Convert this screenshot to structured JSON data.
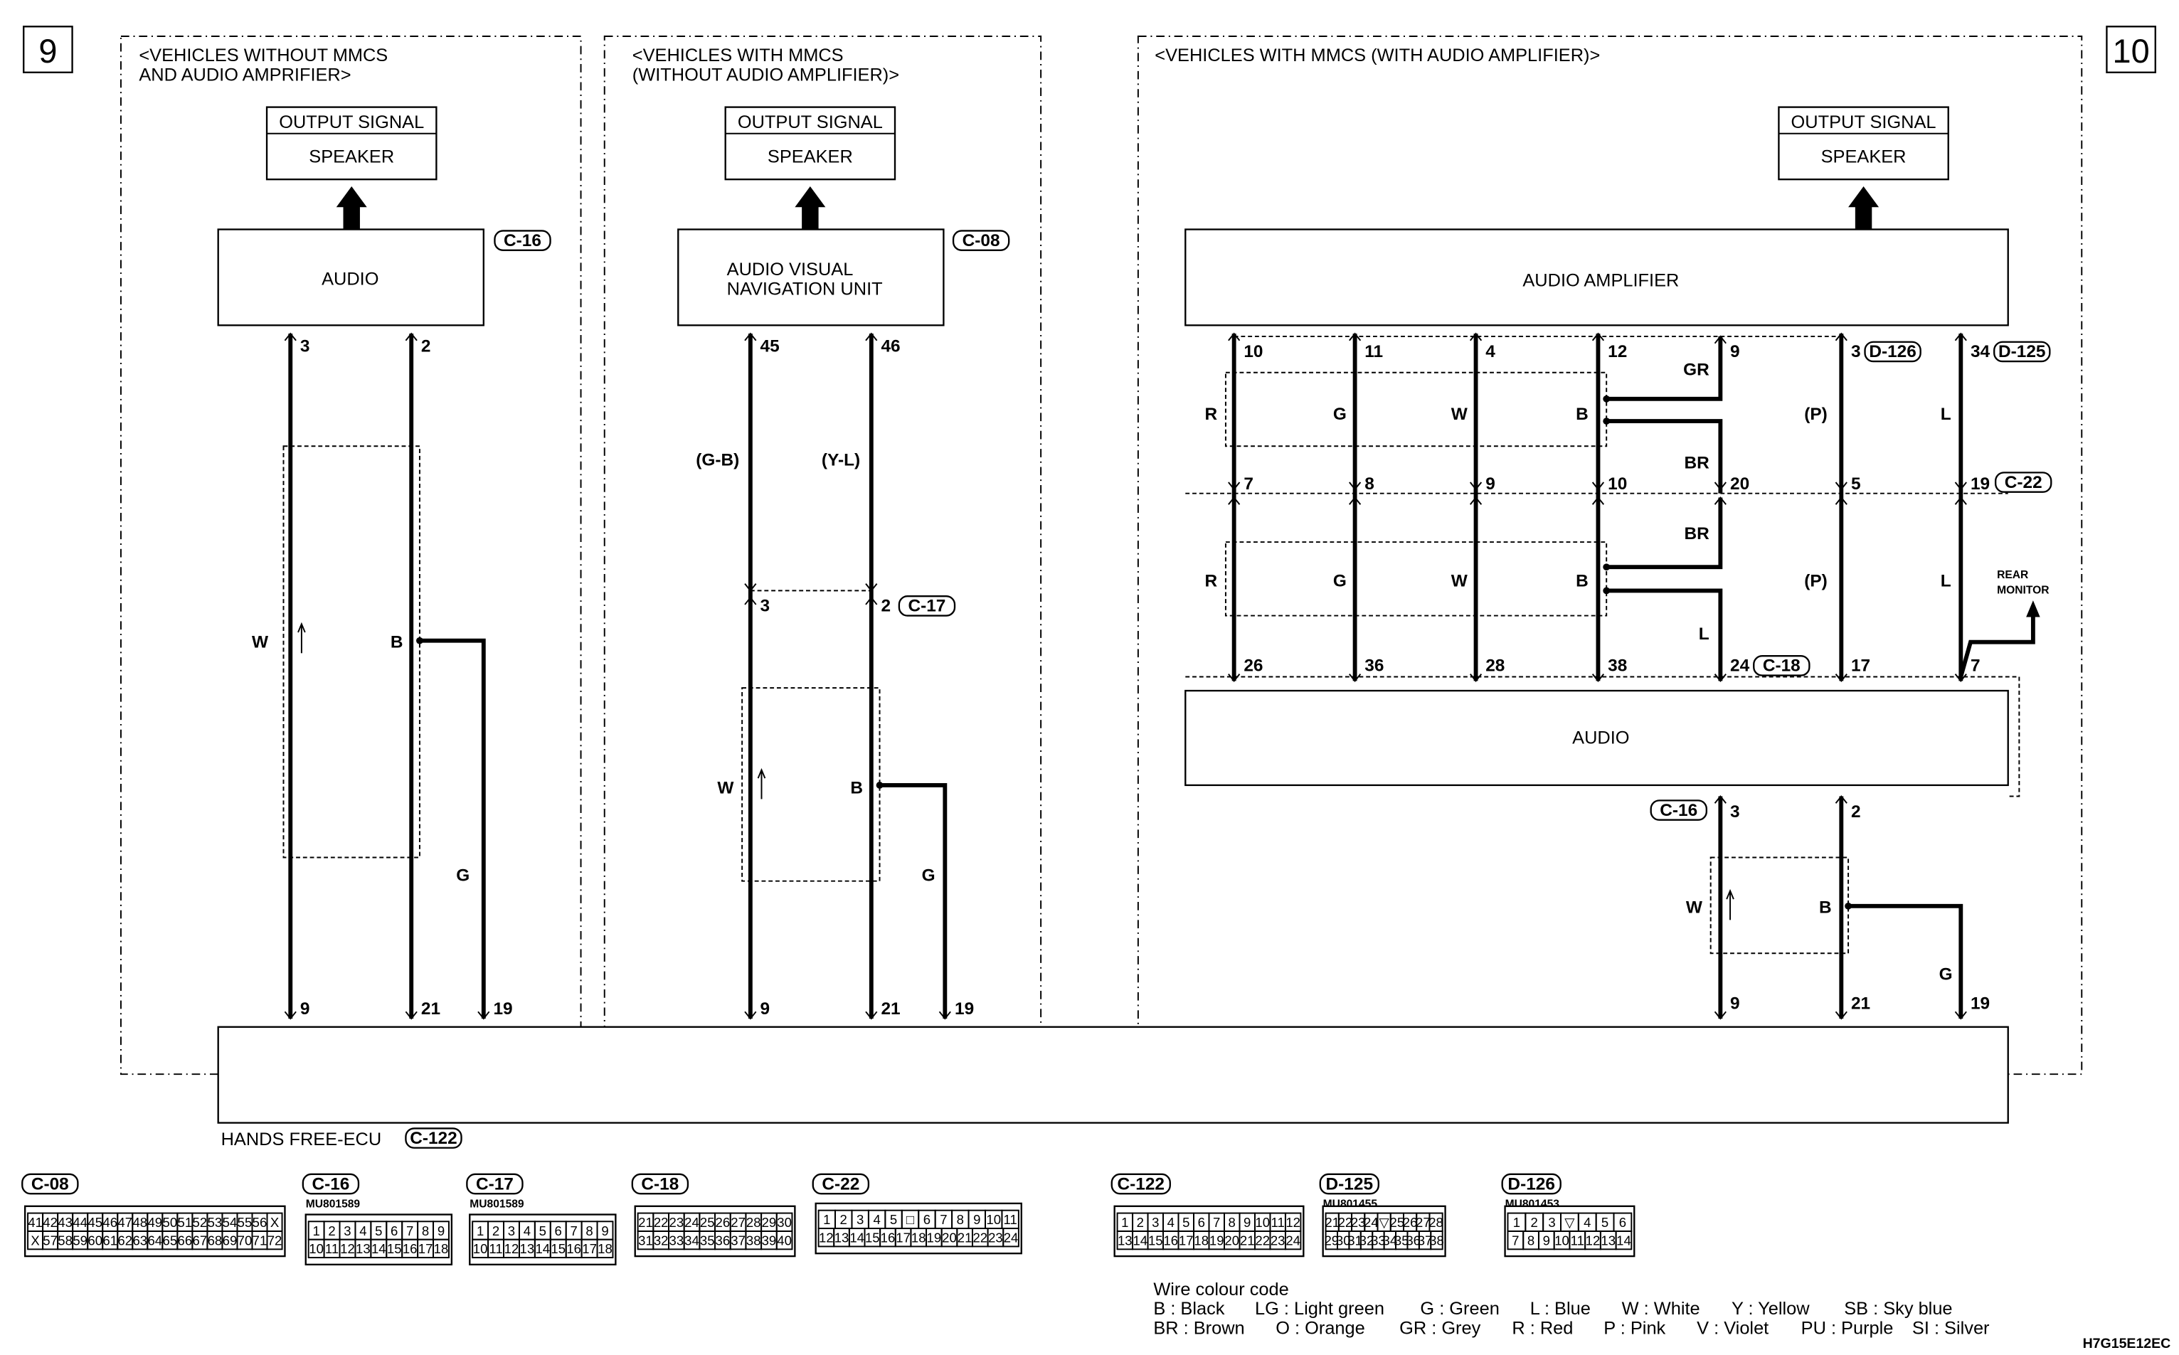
{
  "badges": {
    "left": "9",
    "right": "10"
  },
  "p1": {
    "title": [
      "<VEHICLES WITHOUT MMCS",
      "AND AUDIO AMPRIFIER>"
    ],
    "out_header": "OUTPUT SIGNAL",
    "out_label": "SPEAKER",
    "unit": "AUDIO",
    "unit_conn": "C-16",
    "pins_top": [
      "3",
      "2"
    ],
    "pins_bottom": [
      "9",
      "21",
      "19"
    ],
    "colors": [
      "W",
      "B",
      "G"
    ]
  },
  "p2": {
    "title": [
      "<VEHICLES WITH MMCS",
      "(WITHOUT AUDIO AMPLIFIER)>"
    ],
    "out_header": "OUTPUT SIGNAL",
    "out_label": "SPEAKER",
    "unit": [
      "AUDIO VISUAL",
      "NAVIGATION UNIT"
    ],
    "unit_conn": "C-08",
    "pins_top": [
      "45",
      "46"
    ],
    "upper_colors": [
      "(G-B)",
      "(Y-L)"
    ],
    "mid_pins": [
      "3",
      "2"
    ],
    "mid_conn": "C-17",
    "colors": [
      "W",
      "B",
      "G"
    ],
    "pins_bottom": [
      "9",
      "21",
      "19"
    ]
  },
  "p3": {
    "title": "<VEHICLES WITH MMCS (WITH AUDIO AMPLIFIER)>",
    "out_header": "OUTPUT SIGNAL",
    "out_label": "SPEAKER",
    "amp": "AUDIO AMPLIFIER",
    "amp_pins": [
      "10",
      "11",
      "4",
      "12",
      "9",
      "3",
      "34"
    ],
    "amp_conns": [
      "D-126",
      "D-125"
    ],
    "upper_colors": [
      "R",
      "G",
      "W",
      "B",
      "GR",
      "(P)",
      "L"
    ],
    "mid_pins": [
      "7",
      "8",
      "9",
      "10",
      "20",
      "5",
      "19"
    ],
    "mid_conn": "C-22",
    "branch_colors": [
      "BR",
      "BR"
    ],
    "lower_colors": [
      "R",
      "G",
      "W",
      "B",
      "L",
      "(P)",
      "L"
    ],
    "bottom_pins": [
      "26",
      "36",
      "28",
      "38",
      "24",
      "17",
      "7"
    ],
    "bottom_conn": "C-18",
    "rear": [
      "REAR",
      "MONITOR"
    ],
    "audio": "AUDIO",
    "audio_conn": "C-16",
    "out_pins": [
      "3",
      "2"
    ],
    "colors": [
      "W",
      "B",
      "G"
    ],
    "ecu_pins": [
      "9",
      "21",
      "19"
    ]
  },
  "ecu": {
    "label": "HANDS FREE-ECU",
    "conn": "C-122"
  },
  "connectors": [
    {
      "tag": "C-08",
      "part": "",
      "rows": [
        [
          "41",
          "42",
          "43",
          "44",
          "45",
          "46",
          "47",
          "48",
          "49",
          "50",
          "51",
          "52",
          "53",
          "54",
          "55",
          "56",
          "X"
        ],
        [
          "X",
          "57",
          "58",
          "59",
          "60",
          "61",
          "62",
          "63",
          "64",
          "65",
          "66",
          "67",
          "68",
          "69",
          "70",
          "71",
          "72"
        ]
      ]
    },
    {
      "tag": "C-16",
      "part": "MU801589",
      "rows": [
        [
          "1",
          "2",
          "3",
          "4",
          "5",
          "6",
          "7",
          "8",
          "9"
        ],
        [
          "10",
          "11",
          "12",
          "13",
          "14",
          "15",
          "16",
          "17",
          "18"
        ]
      ]
    },
    {
      "tag": "C-17",
      "part": "MU801589",
      "rows": [
        [
          "1",
          "2",
          "3",
          "4",
          "5",
          "6",
          "7",
          "8",
          "9"
        ],
        [
          "10",
          "11",
          "12",
          "13",
          "14",
          "15",
          "16",
          "17",
          "18"
        ]
      ]
    },
    {
      "tag": "C-18",
      "part": "",
      "rows": [
        [
          "21",
          "22",
          "23",
          "24",
          "25",
          "26",
          "27",
          "28",
          "29",
          "30"
        ],
        [
          "31",
          "32",
          "33",
          "34",
          "35",
          "36",
          "37",
          "38",
          "39",
          "40"
        ]
      ]
    },
    {
      "tag": "C-22",
      "part": "",
      "rows": [
        [
          "1",
          "2",
          "3",
          "4",
          "5",
          "□",
          "6",
          "7",
          "8",
          "9",
          "10",
          "11"
        ],
        [
          "12",
          "13",
          "14",
          "15",
          "16",
          "17",
          "18",
          "19",
          "20",
          "21",
          "22",
          "23",
          "24"
        ]
      ]
    },
    {
      "tag": "C-122",
      "part": "",
      "rows": [
        [
          "1",
          "2",
          "3",
          "4",
          "5",
          "6",
          "7",
          "8",
          "9",
          "10",
          "11",
          "12"
        ],
        [
          "13",
          "14",
          "15",
          "16",
          "17",
          "18",
          "19",
          "20",
          "21",
          "22",
          "23",
          "24"
        ]
      ]
    },
    {
      "tag": "D-125",
      "part": "MU801455",
      "rows": [
        [
          "21",
          "22",
          "23",
          "24",
          "▽",
          "25",
          "26",
          "27",
          "28"
        ],
        [
          "29",
          "30",
          "31",
          "32",
          "33",
          "34",
          "35",
          "36",
          "37",
          "38"
        ]
      ]
    },
    {
      "tag": "D-126",
      "part": "MU801453",
      "rows": [
        [
          "1",
          "2",
          "3",
          "▽",
          "4",
          "5",
          "6"
        ],
        [
          "7",
          "8",
          "9",
          "10",
          "11",
          "12",
          "13",
          "14"
        ]
      ]
    }
  ],
  "legend": {
    "title": "Wire colour code",
    "rows": [
      [
        "B : Black",
        "LG : Light green",
        "G : Green",
        "L : Blue",
        "W : White",
        "Y : Yellow",
        "SB : Sky blue"
      ],
      [
        "BR : Brown",
        "O : Orange",
        "GR : Grey",
        "R : Red",
        "P : Pink",
        "V : Violet",
        "PU : Purple",
        "SI : Silver"
      ]
    ]
  },
  "code": "H7G15E12EC"
}
